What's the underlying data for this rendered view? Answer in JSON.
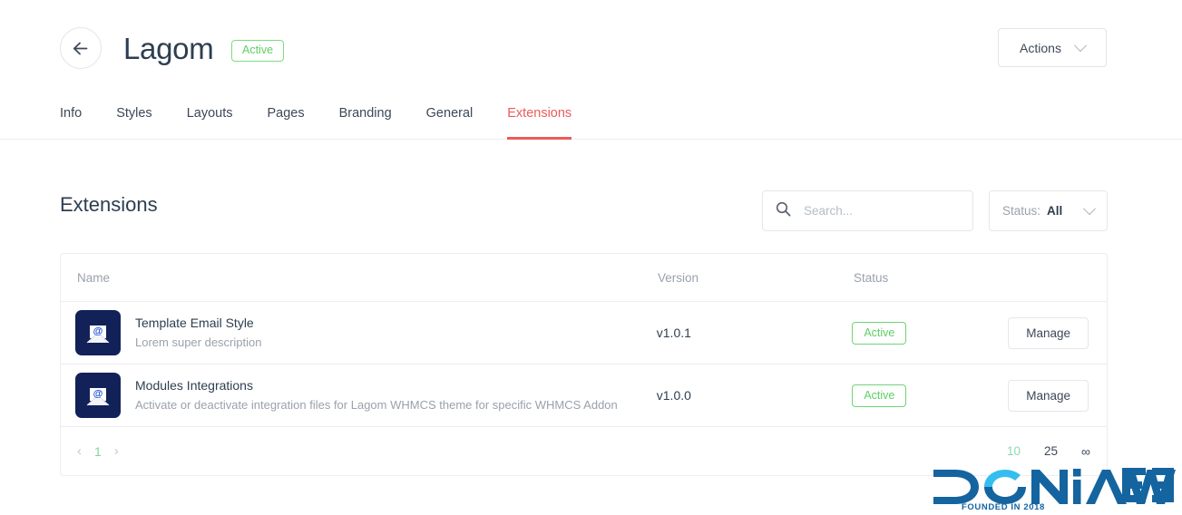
{
  "header": {
    "back_icon": "arrow-left-icon",
    "title": "Lagom",
    "status_badge": "Active",
    "actions_label": "Actions",
    "chevron_icon": "chevron-down-icon"
  },
  "tabs": [
    {
      "label": "Info",
      "active": false
    },
    {
      "label": "Styles",
      "active": false
    },
    {
      "label": "Layouts",
      "active": false
    },
    {
      "label": "Pages",
      "active": false
    },
    {
      "label": "Branding",
      "active": false
    },
    {
      "label": "General",
      "active": false
    },
    {
      "label": "Extensions",
      "active": true
    }
  ],
  "section": {
    "title": "Extensions"
  },
  "search": {
    "icon": "search-icon",
    "value": "",
    "placeholder": "Search..."
  },
  "status_filter": {
    "label": "Status:",
    "value": "All",
    "icon": "chevron-down-icon"
  },
  "table": {
    "columns": [
      "Name",
      "Version",
      "Status",
      ""
    ],
    "rows": [
      {
        "icon": "email-envelope-icon",
        "name": "Template Email Style",
        "description": "Lorem super description",
        "version": "v1.0.1",
        "status": "Active",
        "action": "Manage"
      },
      {
        "icon": "email-envelope-icon",
        "name": "Modules Integrations",
        "description": "Activate or deactivate integration files for Lagom WHMCS theme for specific WHMCS Addon",
        "version": "v1.0.0",
        "status": "Active",
        "action": "Manage"
      }
    ]
  },
  "pagination": {
    "prev_icon": "chevron-left-icon",
    "next_icon": "chevron-right-icon",
    "current_page": "1",
    "page_sizes": [
      "10",
      "25"
    ],
    "infinite": "∞"
  },
  "watermark": {
    "name": "DONIAWEB",
    "tagline": "FOUNDED IN 2018"
  },
  "colors": {
    "accent_red": "#ea5b5b",
    "active_green": "#5fcf63",
    "title_dark": "#2d3e50",
    "muted": "#9aa1ac",
    "icon_navy": "#132159",
    "pager_green": "#7fd6a0",
    "logo_blue": "#1464a0",
    "logo_cyan": "#35bdf0"
  }
}
